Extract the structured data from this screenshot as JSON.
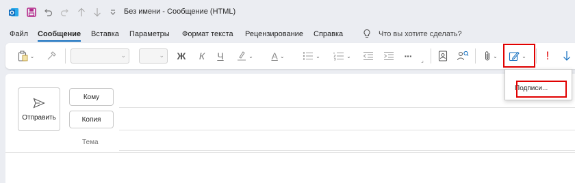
{
  "titlebar": {
    "title": "Без имени  -  Сообщение (HTML)",
    "icons": [
      "outlook-icon",
      "save-icon",
      "undo-icon",
      "redo-icon",
      "arrow-up-icon",
      "arrow-down-icon",
      "customize-icon"
    ],
    "accent": "#0f6cbd",
    "save_color": "#b4298a"
  },
  "menu": {
    "items": [
      "Файл",
      "Сообщение",
      "Вставка",
      "Параметры",
      "Формат текста",
      "Рецензирование",
      "Справка"
    ],
    "active": "Сообщение",
    "search_placeholder": "Что вы хотите сделать?"
  },
  "ribbon": {
    "bold": "Ж",
    "italic": "К",
    "underline": "Ч",
    "font_color_letter": "A",
    "more": "···",
    "importance_high": "!",
    "highlight_color": "#e00000"
  },
  "signature_popup": {
    "item": "Подписи..."
  },
  "compose": {
    "send": "Отправить",
    "to": "Кому",
    "cc": "Копия",
    "subject": "Тема"
  }
}
